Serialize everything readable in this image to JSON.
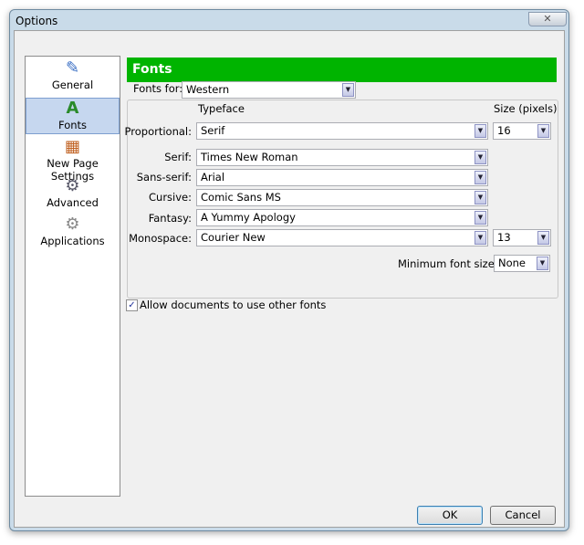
{
  "window": {
    "title": "Options",
    "close_label": "✕"
  },
  "sidebar": {
    "items": [
      {
        "label": "General",
        "icon": "✎"
      },
      {
        "label": "Fonts",
        "icon": "A"
      },
      {
        "label": "New Page Settings",
        "icon": "▦"
      },
      {
        "label": "Advanced",
        "icon": "⚙"
      },
      {
        "label": "Applications",
        "icon": "⚙"
      }
    ]
  },
  "header": {
    "title": "Fonts"
  },
  "fonts_for": {
    "label": "Fonts for:",
    "value": "Western"
  },
  "columns": {
    "typeface": "Typeface",
    "size": "Size (pixels)"
  },
  "rows": [
    {
      "label": "Proportional:",
      "value": "Serif",
      "size": "16"
    },
    {
      "label": "Serif:",
      "value": "Times New Roman"
    },
    {
      "label": "Sans-serif:",
      "value": "Arial"
    },
    {
      "label": "Cursive:",
      "value": "Comic Sans MS"
    },
    {
      "label": "Fantasy:",
      "value": "A Yummy Apology"
    },
    {
      "label": "Monospace:",
      "value": "Courier New",
      "size": "13"
    }
  ],
  "min_font": {
    "label": "Minimum font size:",
    "value": "None"
  },
  "allow_docs": {
    "label": "Allow documents to use other fonts",
    "checked": true,
    "mark": "✓"
  },
  "buttons": {
    "ok": "OK",
    "cancel": "Cancel"
  },
  "colors": {
    "header": "#00b400"
  }
}
